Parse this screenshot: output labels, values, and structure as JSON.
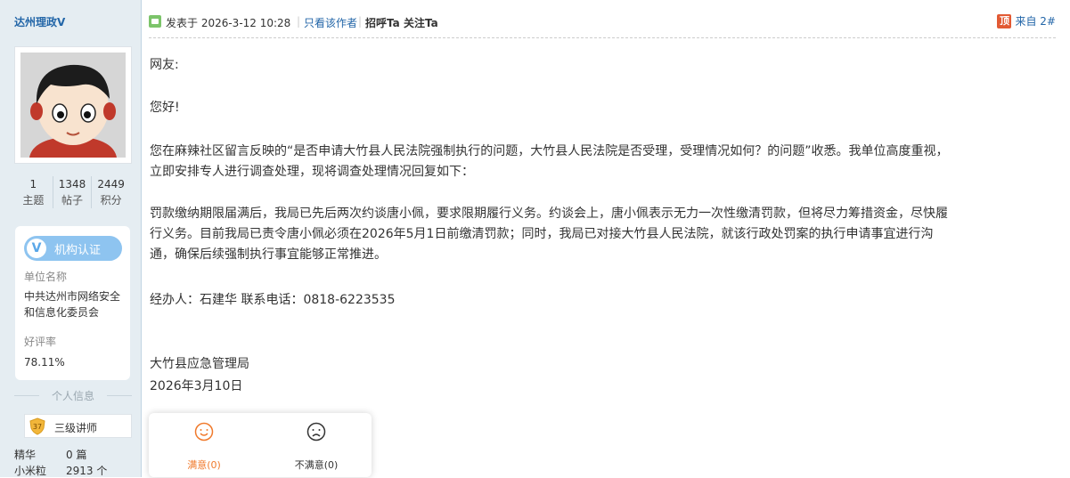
{
  "sidebar": {
    "username": "达州理政V",
    "stats": [
      {
        "value": "1",
        "label": "主题"
      },
      {
        "value": "1348",
        "label": "帖子"
      },
      {
        "value": "2449",
        "label": "积分"
      }
    ],
    "cert": {
      "badge": "机构认证",
      "unit_label": "单位名称",
      "unit_value": "中共达州市网络安全和信息化委员会",
      "rating_label": "好评率",
      "rating_value": "78.11%"
    },
    "personal_info_title": "个人信息",
    "level": {
      "number": "37",
      "title": "三级讲师"
    },
    "rows": [
      {
        "label": "精华",
        "value": "0 篇"
      },
      {
        "label": "小米粒",
        "value": "2913 个"
      }
    ]
  },
  "post": {
    "posted_at": "发表于 2026-3-12 10:28",
    "sep": "|",
    "only_author": "只看该作者",
    "greet": "招呼Ta",
    "follow": "关注Ta",
    "top_badge": "顶",
    "floor": "来自 2#",
    "paragraphs": [
      "网友:",
      "您好!",
      "您在麻辣社区留言反映的“是否申请大竹县人民法院强制执行的问题，大竹县人民法院是否受理，受理情况如何？的问题”收悉。我单位高度重视，立即安排专人进行调查处理，现将调查处理情况回复如下：",
      "罚款缴纳期限届满后，我局已先后两次约谈唐小佩，要求限期履行义务。约谈会上，唐小佩表示无力一次性缴清罚款，但将尽力筹措资金，尽快履行义务。目前我局已责令唐小佩必须在2026年5月1日前缴清罚款；同时，我局已对接大竹县人民法院，就该行政处罚案的执行申请事宜进行沟通，确保后续强制执行事宜能够正常推进。",
      "经办人：石建华 联系电话：0818-6223535",
      "大竹县应急管理局",
      "2026年3月10日"
    ]
  },
  "rating": {
    "satisfied": "满意(0)",
    "unsatisfied": "不满意(0)",
    "satisfied_color": "#f07a2c",
    "unsatisfied_color": "#333333"
  }
}
